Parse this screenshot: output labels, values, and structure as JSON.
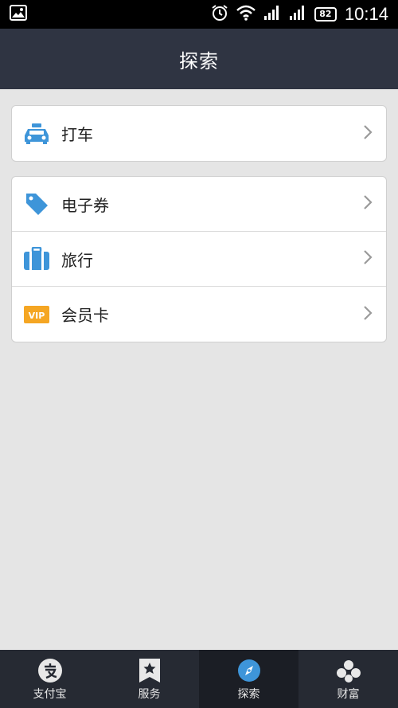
{
  "status_bar": {
    "battery": "82",
    "time": "10:14"
  },
  "header": {
    "title": "探索"
  },
  "groups": [
    {
      "items": [
        {
          "label": "打车",
          "icon": "taxi-icon"
        }
      ]
    },
    {
      "items": [
        {
          "label": "电子券",
          "icon": "coupon-tag-icon"
        },
        {
          "label": "旅行",
          "icon": "suitcase-icon"
        },
        {
          "label": "会员卡",
          "icon": "vip-card-icon",
          "badge": "VIP"
        }
      ]
    }
  ],
  "bottom_nav": {
    "items": [
      {
        "label": "支付宝",
        "icon": "alipay-icon"
      },
      {
        "label": "服务",
        "icon": "star-icon"
      },
      {
        "label": "探索",
        "icon": "explore-icon",
        "active": true
      },
      {
        "label": "财富",
        "icon": "wealth-icon"
      }
    ]
  },
  "colors": {
    "header_bg": "#2f3442",
    "icon_blue": "#3e95d9",
    "vip_orange": "#f5a623",
    "nav_bg": "#262a33"
  }
}
